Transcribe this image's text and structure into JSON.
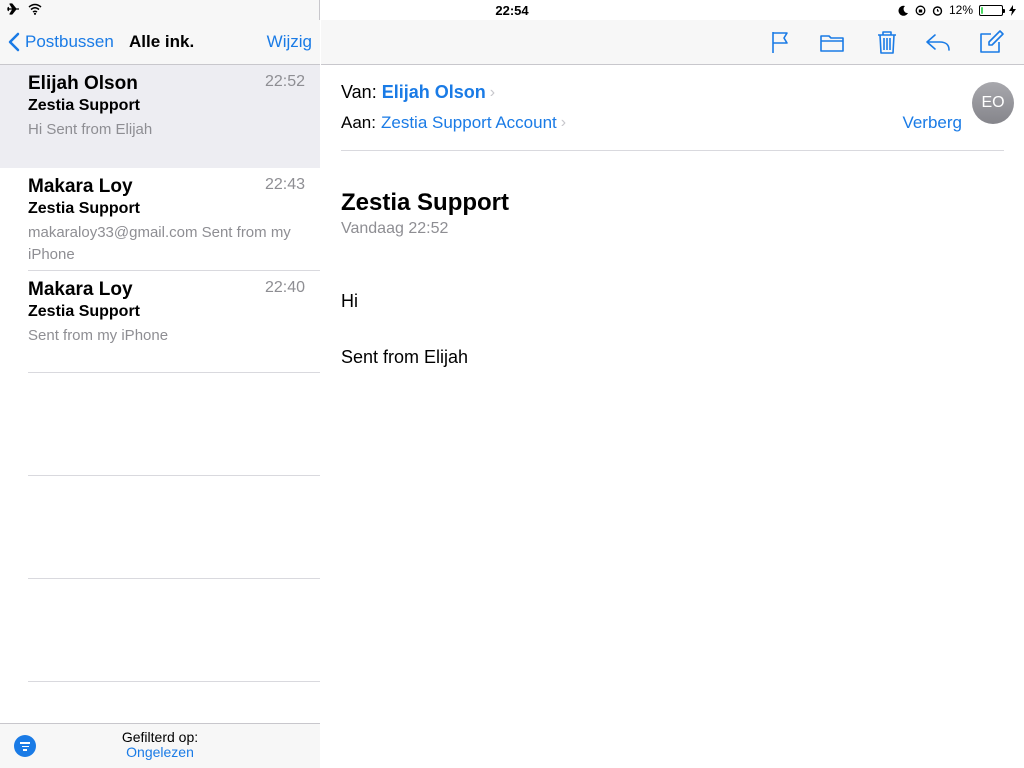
{
  "status": {
    "time": "22:54",
    "battery": "12%",
    "battery_level": 0.12
  },
  "leftnav": {
    "back_label": "Postbussen",
    "title": "Alle ink.",
    "edit_label": "Wijzig"
  },
  "mails": [
    {
      "sender": "Elijah Olson",
      "time": "22:52",
      "subject": "Zestia Support",
      "preview": "Hi Sent from Elijah"
    },
    {
      "sender": "Makara Loy",
      "time": "22:43",
      "subject": "Zestia Support",
      "preview": "makaraloy33@gmail.com Sent from my iPhone"
    },
    {
      "sender": "Makara Loy",
      "time": "22:40",
      "subject": "Zestia Support",
      "preview": "Sent from my iPhone"
    }
  ],
  "footer": {
    "filter_label": "Gefilterd op:",
    "filter_value": "Ongelezen"
  },
  "toolbar": {
    "icons": [
      "flag-icon",
      "folder-icon",
      "trash-icon",
      "reply-icon",
      "compose-icon"
    ]
  },
  "message": {
    "from_label": "Van:",
    "from_name": "Elijah Olson",
    "to_label": "Aan:",
    "to_name": "Zestia Support Account",
    "hide_label": "Verberg",
    "avatar_initials": "EO",
    "subject": "Zestia Support",
    "date": "Vandaag 22:52",
    "body_line1": "Hi",
    "body_line2": "Sent from Elijah"
  },
  "colors": {
    "accent": "#1a7be6",
    "selected_row": "#ededf2",
    "secondary_text": "#8e8e93"
  }
}
